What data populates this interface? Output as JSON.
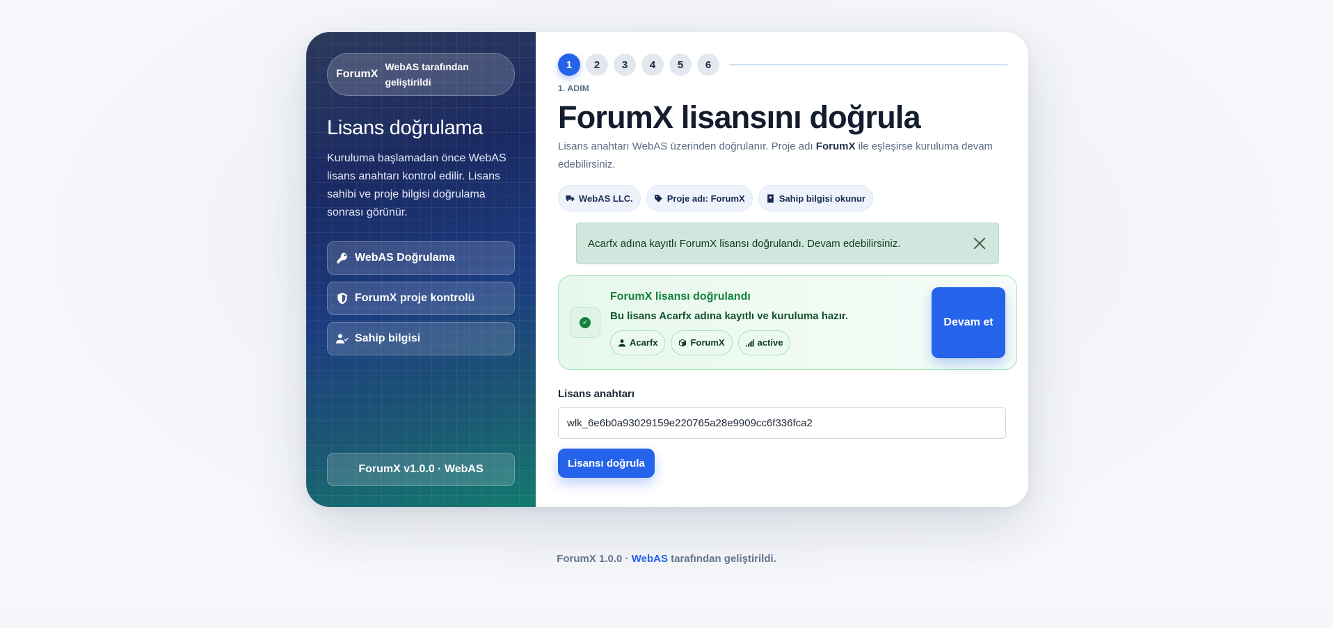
{
  "sidebar": {
    "brand_name": "ForumX",
    "brand_sub": "WebAS tarafından geliştirildi",
    "title": "Lisans doğrulama",
    "description": "Kuruluma başlamadan önce WebAS lisans anahtarı kontrol edilir. Lisans sahibi ve proje bilgisi doğrulama sonrası görünür.",
    "items": [
      {
        "label": "WebAS Doğrulama",
        "icon": "key-icon"
      },
      {
        "label": "ForumX proje kontrolü",
        "icon": "shield-icon"
      },
      {
        "label": "Sahip bilgisi",
        "icon": "user-check-icon"
      }
    ],
    "footer": "ForumX v1.0.0 · WebAS"
  },
  "stepper": {
    "steps": [
      "1",
      "2",
      "3",
      "4",
      "5",
      "6"
    ],
    "active_step": 1,
    "step_label": "1. ADIM"
  },
  "main": {
    "title": "ForumX lisansını doğrula",
    "desc_prefix": "Lisans anahtarı WebAS üzerinden doğrulanır. Proje adı ",
    "desc_bold": "ForumX",
    "desc_suffix": " ile eşleşirse kuruluma devam edebilirsiniz.",
    "chips": [
      {
        "label": "WebAS LLC.",
        "icon": "truck-icon"
      },
      {
        "label": "Proje adı: ForumX",
        "icon": "tag-icon"
      },
      {
        "label": "Sahip bilgisi okunur",
        "icon": "id-card-icon"
      }
    ]
  },
  "alert": {
    "message": "Acarfx adına kayıtlı ForumX lisansı doğrulandı. Devam edebilirsiniz."
  },
  "verification": {
    "title": "ForumX lisansı doğrulandı",
    "subtitle": "Bu lisans Acarfx adına kayıtlı ve kuruluma hazır.",
    "chips": [
      {
        "label": "Acarfx",
        "icon": "user-icon"
      },
      {
        "label": "ForumX",
        "icon": "cube-icon"
      },
      {
        "label": "active",
        "icon": "signal-icon"
      }
    ],
    "continue_label": "Devam et"
  },
  "form": {
    "license_label": "Lisans anahtarı",
    "license_value": "wlk_6e6b0a93029159e220765a28e9909cc6f336fca2",
    "submit_label": "Lisansı doğrula"
  },
  "footer": {
    "prefix": "ForumX 1.0.0 · ",
    "link": "WebAS",
    "suffix": " tarafından geliştirildi."
  },
  "colors": {
    "accent": "#2563eb",
    "success": "#15803d",
    "alert_bg": "#d1e7dd"
  }
}
